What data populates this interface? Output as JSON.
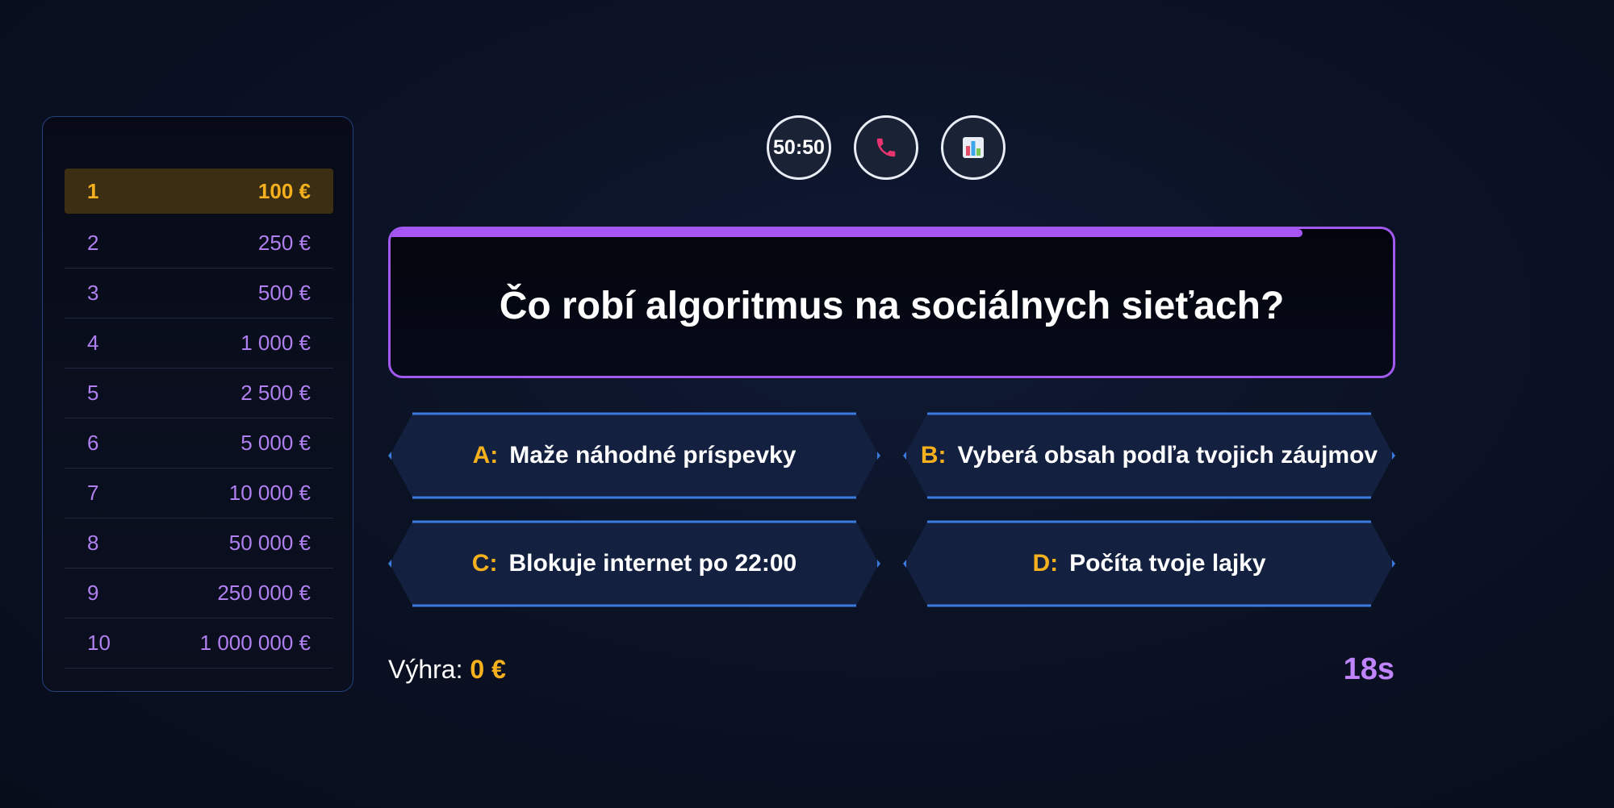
{
  "ladder": {
    "rows": [
      {
        "level": "1",
        "prize": "100 €"
      },
      {
        "level": "2",
        "prize": "250 €"
      },
      {
        "level": "3",
        "prize": "500 €"
      },
      {
        "level": "4",
        "prize": "1 000 €"
      },
      {
        "level": "5",
        "prize": "2 500 €"
      },
      {
        "level": "6",
        "prize": "5 000 €"
      },
      {
        "level": "7",
        "prize": "10 000 €"
      },
      {
        "level": "8",
        "prize": "50 000 €"
      },
      {
        "level": "9",
        "prize": "250 000 €"
      },
      {
        "level": "10",
        "prize": "1 000 000 €"
      }
    ],
    "active_level": "1"
  },
  "lifelines": {
    "fifty_fifty_label": "50:50",
    "phone_icon": "phone-icon",
    "audience_icon": "bar-chart-icon"
  },
  "question": {
    "text": "Čo robí algoritmus na sociálnych sieťach?",
    "time_remaining_fraction": 0.91
  },
  "answers": [
    {
      "letter": "A:",
      "text": "Maže náhodné príspevky"
    },
    {
      "letter": "B:",
      "text": "Vyberá obsah podľa tvojich záujmov"
    },
    {
      "letter": "C:",
      "text": "Blokuje internet po 22:00"
    },
    {
      "letter": "D:",
      "text": "Počíta tvoje lajky"
    }
  ],
  "footer": {
    "winnings_label": "Výhra:",
    "winnings_amount": "0 €",
    "timer": "18s"
  },
  "colors": {
    "accent_purple": "#a855f7",
    "gold": "#f5b01e",
    "answer_border": "#3b7be0",
    "answer_fill": "#13203f"
  }
}
